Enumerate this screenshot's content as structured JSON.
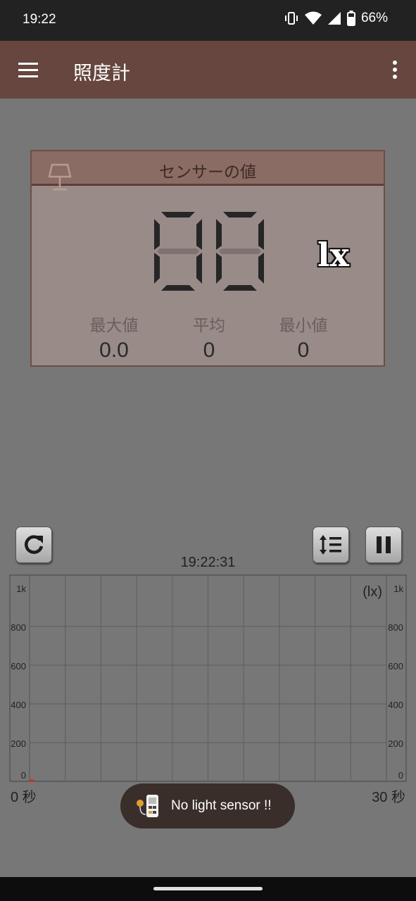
{
  "status_bar": {
    "time": "19:22",
    "battery_percent": "66%"
  },
  "app_bar": {
    "title": "照度計"
  },
  "sensor_panel": {
    "header": "センサーの値",
    "display_value": "00",
    "unit": "lx",
    "stats": [
      {
        "label": "最大値",
        "value": "0.0"
      },
      {
        "label": "平均",
        "value": "0"
      },
      {
        "label": "最小値",
        "value": "0"
      }
    ]
  },
  "controls": {
    "timestamp": "19:22:31"
  },
  "chart_data": {
    "type": "line",
    "unit_label": "(lx)",
    "y_ticks": [
      "0",
      "200",
      "400",
      "600",
      "800",
      "1k"
    ],
    "ylim": [
      0,
      1000
    ],
    "x_start_label": "0 秒",
    "x_end_label": "30 秒",
    "xlim": [
      0,
      30
    ],
    "grid": true,
    "series": [
      {
        "x": [
          0
        ],
        "y": [
          0
        ],
        "color": "#e02020"
      }
    ]
  },
  "toast": {
    "message": "No light sensor !!"
  },
  "colors": {
    "app_bar": "#66463e",
    "panel_header": "#8a6c64",
    "panel_body": "#988b88",
    "background": "#777777"
  }
}
